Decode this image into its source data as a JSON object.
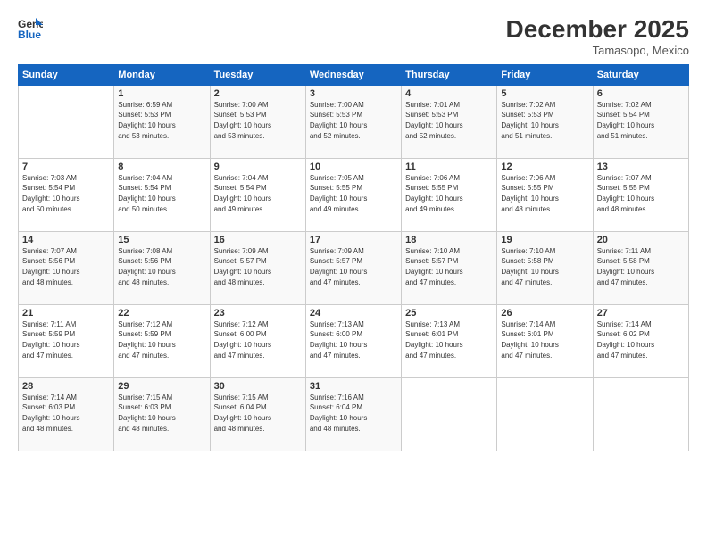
{
  "header": {
    "logo_line1": "General",
    "logo_line2": "Blue",
    "month": "December 2025",
    "location": "Tamasopo, Mexico"
  },
  "weekdays": [
    "Sunday",
    "Monday",
    "Tuesday",
    "Wednesday",
    "Thursday",
    "Friday",
    "Saturday"
  ],
  "weeks": [
    [
      {
        "day": "",
        "info": ""
      },
      {
        "day": "1",
        "info": "Sunrise: 6:59 AM\nSunset: 5:53 PM\nDaylight: 10 hours\nand 53 minutes."
      },
      {
        "day": "2",
        "info": "Sunrise: 7:00 AM\nSunset: 5:53 PM\nDaylight: 10 hours\nand 53 minutes."
      },
      {
        "day": "3",
        "info": "Sunrise: 7:00 AM\nSunset: 5:53 PM\nDaylight: 10 hours\nand 52 minutes."
      },
      {
        "day": "4",
        "info": "Sunrise: 7:01 AM\nSunset: 5:53 PM\nDaylight: 10 hours\nand 52 minutes."
      },
      {
        "day": "5",
        "info": "Sunrise: 7:02 AM\nSunset: 5:53 PM\nDaylight: 10 hours\nand 51 minutes."
      },
      {
        "day": "6",
        "info": "Sunrise: 7:02 AM\nSunset: 5:54 PM\nDaylight: 10 hours\nand 51 minutes."
      }
    ],
    [
      {
        "day": "7",
        "info": "Sunrise: 7:03 AM\nSunset: 5:54 PM\nDaylight: 10 hours\nand 50 minutes."
      },
      {
        "day": "8",
        "info": "Sunrise: 7:04 AM\nSunset: 5:54 PM\nDaylight: 10 hours\nand 50 minutes."
      },
      {
        "day": "9",
        "info": "Sunrise: 7:04 AM\nSunset: 5:54 PM\nDaylight: 10 hours\nand 49 minutes."
      },
      {
        "day": "10",
        "info": "Sunrise: 7:05 AM\nSunset: 5:55 PM\nDaylight: 10 hours\nand 49 minutes."
      },
      {
        "day": "11",
        "info": "Sunrise: 7:06 AM\nSunset: 5:55 PM\nDaylight: 10 hours\nand 49 minutes."
      },
      {
        "day": "12",
        "info": "Sunrise: 7:06 AM\nSunset: 5:55 PM\nDaylight: 10 hours\nand 48 minutes."
      },
      {
        "day": "13",
        "info": "Sunrise: 7:07 AM\nSunset: 5:55 PM\nDaylight: 10 hours\nand 48 minutes."
      }
    ],
    [
      {
        "day": "14",
        "info": "Sunrise: 7:07 AM\nSunset: 5:56 PM\nDaylight: 10 hours\nand 48 minutes."
      },
      {
        "day": "15",
        "info": "Sunrise: 7:08 AM\nSunset: 5:56 PM\nDaylight: 10 hours\nand 48 minutes."
      },
      {
        "day": "16",
        "info": "Sunrise: 7:09 AM\nSunset: 5:57 PM\nDaylight: 10 hours\nand 48 minutes."
      },
      {
        "day": "17",
        "info": "Sunrise: 7:09 AM\nSunset: 5:57 PM\nDaylight: 10 hours\nand 47 minutes."
      },
      {
        "day": "18",
        "info": "Sunrise: 7:10 AM\nSunset: 5:57 PM\nDaylight: 10 hours\nand 47 minutes."
      },
      {
        "day": "19",
        "info": "Sunrise: 7:10 AM\nSunset: 5:58 PM\nDaylight: 10 hours\nand 47 minutes."
      },
      {
        "day": "20",
        "info": "Sunrise: 7:11 AM\nSunset: 5:58 PM\nDaylight: 10 hours\nand 47 minutes."
      }
    ],
    [
      {
        "day": "21",
        "info": "Sunrise: 7:11 AM\nSunset: 5:59 PM\nDaylight: 10 hours\nand 47 minutes."
      },
      {
        "day": "22",
        "info": "Sunrise: 7:12 AM\nSunset: 5:59 PM\nDaylight: 10 hours\nand 47 minutes."
      },
      {
        "day": "23",
        "info": "Sunrise: 7:12 AM\nSunset: 6:00 PM\nDaylight: 10 hours\nand 47 minutes."
      },
      {
        "day": "24",
        "info": "Sunrise: 7:13 AM\nSunset: 6:00 PM\nDaylight: 10 hours\nand 47 minutes."
      },
      {
        "day": "25",
        "info": "Sunrise: 7:13 AM\nSunset: 6:01 PM\nDaylight: 10 hours\nand 47 minutes."
      },
      {
        "day": "26",
        "info": "Sunrise: 7:14 AM\nSunset: 6:01 PM\nDaylight: 10 hours\nand 47 minutes."
      },
      {
        "day": "27",
        "info": "Sunrise: 7:14 AM\nSunset: 6:02 PM\nDaylight: 10 hours\nand 47 minutes."
      }
    ],
    [
      {
        "day": "28",
        "info": "Sunrise: 7:14 AM\nSunset: 6:03 PM\nDaylight: 10 hours\nand 48 minutes."
      },
      {
        "day": "29",
        "info": "Sunrise: 7:15 AM\nSunset: 6:03 PM\nDaylight: 10 hours\nand 48 minutes."
      },
      {
        "day": "30",
        "info": "Sunrise: 7:15 AM\nSunset: 6:04 PM\nDaylight: 10 hours\nand 48 minutes."
      },
      {
        "day": "31",
        "info": "Sunrise: 7:16 AM\nSunset: 6:04 PM\nDaylight: 10 hours\nand 48 minutes."
      },
      {
        "day": "",
        "info": ""
      },
      {
        "day": "",
        "info": ""
      },
      {
        "day": "",
        "info": ""
      }
    ]
  ]
}
